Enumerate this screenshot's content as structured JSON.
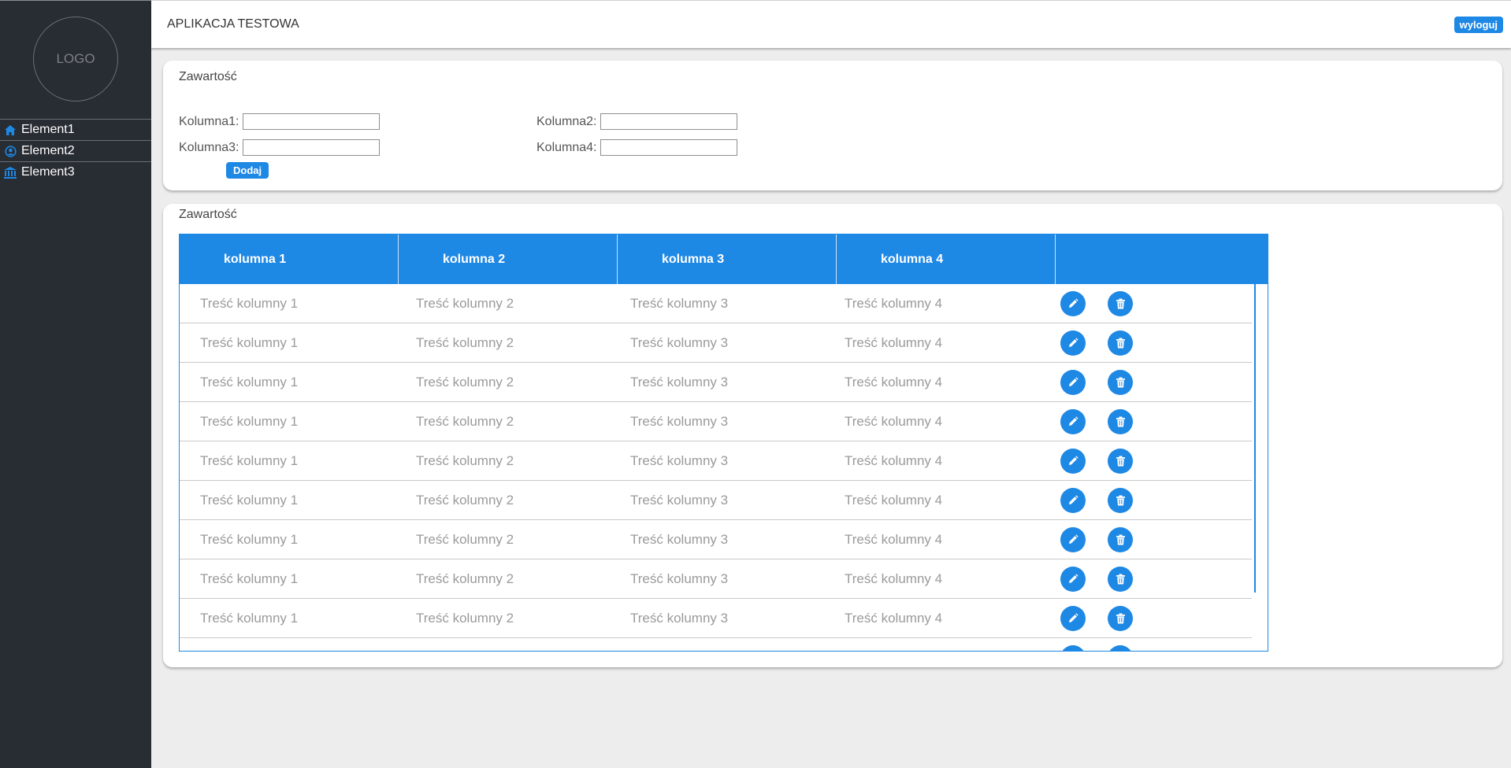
{
  "sidebar": {
    "logo": "LOGO",
    "items": [
      {
        "label": "Element1",
        "icon": "home-icon"
      },
      {
        "label": "Element2",
        "icon": "user-circle-icon"
      },
      {
        "label": "Element3",
        "icon": "bank-icon"
      }
    ]
  },
  "header": {
    "title": "APLIKACJA TESTOWA",
    "logout_label": "wyloguj"
  },
  "form_card": {
    "title": "Zawartość",
    "fields": [
      {
        "label": "Kolumna1:",
        "value": ""
      },
      {
        "label": "Kolumna2:",
        "value": ""
      },
      {
        "label": "Kolumna3:",
        "value": ""
      },
      {
        "label": "Kolumna4:",
        "value": ""
      }
    ],
    "add_label": "Dodaj"
  },
  "table_card": {
    "title": "Zawartość",
    "columns": [
      "kolumna 1",
      "kolumna 2",
      "kolumna 3",
      "kolumna 4"
    ],
    "rows": [
      [
        "Treść kolumny 1",
        "Treść kolumny 2",
        "Treść kolumny 3",
        "Treść kolumny 4"
      ],
      [
        "Treść kolumny 1",
        "Treść kolumny 2",
        "Treść kolumny 3",
        "Treść kolumny 4"
      ],
      [
        "Treść kolumny 1",
        "Treść kolumny 2",
        "Treść kolumny 3",
        "Treść kolumny 4"
      ],
      [
        "Treść kolumny 1",
        "Treść kolumny 2",
        "Treść kolumny 3",
        "Treść kolumny 4"
      ],
      [
        "Treść kolumny 1",
        "Treść kolumny 2",
        "Treść kolumny 3",
        "Treść kolumny 4"
      ],
      [
        "Treść kolumny 1",
        "Treść kolumny 2",
        "Treść kolumny 3",
        "Treść kolumny 4"
      ],
      [
        "Treść kolumny 1",
        "Treść kolumny 2",
        "Treść kolumny 3",
        "Treść kolumny 4"
      ],
      [
        "Treść kolumny 1",
        "Treść kolumny 2",
        "Treść kolumny 3",
        "Treść kolumny 4"
      ],
      [
        "Treść kolumny 1",
        "Treść kolumny 2",
        "Treść kolumny 3",
        "Treść kolumny 4"
      ],
      [
        "",
        "",
        "",
        ""
      ]
    ],
    "row_actions": [
      "pencil-icon",
      "trash-icon"
    ]
  },
  "colors": {
    "accent": "#1e88e5",
    "sidebar_bg": "#282c33",
    "page_bg": "#ededed"
  }
}
